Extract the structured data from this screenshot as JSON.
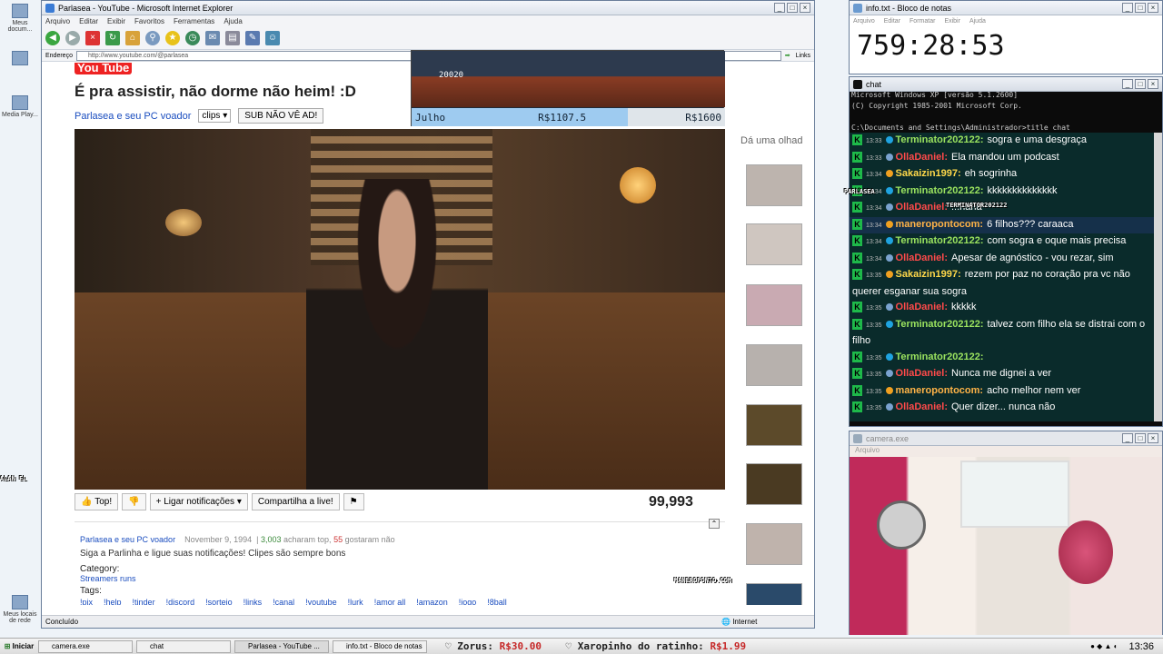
{
  "desktop": {
    "icons": [
      "Meus docum...",
      "",
      "Media Play...",
      "Meus locais de rede"
    ],
    "overlay_alan": "ALAN EL"
  },
  "ie": {
    "title": "Parlasea - YouTube - Microsoft Internet Explorer",
    "menu": [
      "Arquivo",
      "Editar",
      "Exibir",
      "Favoritos",
      "Ferramentas",
      "Ajuda"
    ],
    "address_label": "Endereço",
    "address": "http://www.youtube.com/@parlasea",
    "links": "Links",
    "status": "Concluído",
    "zone": "Internet"
  },
  "page": {
    "logo": "You Tube",
    "video_title": "É pra assistir, não dorme não heim! :D",
    "channel": "Parlasea e seu PC voador",
    "dropdown": "clips",
    "sub_button": "SUB NÃO VÊ AD!",
    "sidebar_hint": "Dá uma olhad",
    "actions": {
      "like": "Top!",
      "notify": "Ligar notificações",
      "share": "Compartilha a live!"
    },
    "views": "99,993",
    "desc": {
      "channel": "Parlasea e seu PC voador",
      "date": "November 9, 1994",
      "likes": "3,003",
      "likes_suffix": "acharam top,",
      "dislikes": "55",
      "dislikes_suffix": "gostaram não",
      "text": "Siga a Parlinha e ligue suas notificações! Clipes são sempre bons",
      "category_label": "Category:",
      "category": "Streamers runs",
      "tags_label": "Tags:",
      "tags": [
        "!pix",
        "!help",
        "!tinder",
        "!discord",
        "!sorteio",
        "!links",
        "!canal",
        "!youtube",
        "!lurk",
        "!amor all",
        "!amazon",
        "!jogo",
        "!8ball"
      ]
    },
    "overlay_manero": "MANEROPONTO.COM"
  },
  "game": {
    "month": "Julho",
    "money": "R$1107.5",
    "goal": "R$1600",
    "score": "20020"
  },
  "notepad": {
    "title": "info.txt - Bloco de notas",
    "menu": [
      "Arquivo",
      "Editar",
      "Formatar",
      "Exibir",
      "Ajuda"
    ],
    "clock": "759:28:53"
  },
  "chat": {
    "title": "chat",
    "header": "Microsoft Windows XP [versão 5.1.2600]\n(C) Copyright 1985-2001 Microsoft Corp.\n\nC:\\Documents and Settings\\Administrador>title chat\n\nC:\\Documents and Settings\\Administrador>chat start",
    "overlay_parlasea": "PARLASEA",
    "overlay_term": "TERMINATOR202122",
    "messages": [
      {
        "time": "13:33",
        "user": "Terminator202122:",
        "color": "green",
        "text": "sogra e uma desgraça",
        "hl": false
      },
      {
        "time": "13:33",
        "user": "OllaDaniel:",
        "color": "red",
        "text": "Ela mandou um podcast",
        "hl": false
      },
      {
        "time": "13:34",
        "user": "Sakaizin1997:",
        "color": "yellow",
        "text": "eh sogrinha",
        "hl": false
      },
      {
        "time": "13:34",
        "user": "Terminator202122:",
        "color": "green",
        "text": "kkkkkkkkkkkkkk",
        "hl": false
      },
      {
        "time": "13:34",
        "user": "OllaDaniel:",
        "color": "red",
        "text": "...haha",
        "hl": false
      },
      {
        "time": "13:34",
        "user": "maneropontocom:",
        "color": "orange",
        "text": "6 filhos??? caraaca",
        "hl": true
      },
      {
        "time": "13:34",
        "user": "Terminator202122:",
        "color": "green",
        "text": "com sogra e oque mais precisa",
        "hl": false
      },
      {
        "time": "13:34",
        "user": "OllaDaniel:",
        "color": "red",
        "text": "Apesar de agnóstico - vou rezar, sim",
        "hl": false
      },
      {
        "time": "13:35",
        "user": "Sakaizin1997:",
        "color": "yellow",
        "text": "rezem por paz no coração pra vc não querer esganar sua sogra",
        "hl": false
      },
      {
        "time": "13:35",
        "user": "OllaDaniel:",
        "color": "red",
        "text": "kkkkk",
        "hl": false
      },
      {
        "time": "13:35",
        "user": "Terminator202122:",
        "color": "green",
        "text": "talvez com filho ela se distrai com o filho",
        "hl": false
      },
      {
        "time": "13:35",
        "user": "Terminator202122:",
        "color": "green",
        "text": "",
        "hl": false
      },
      {
        "time": "13:35",
        "user": "OllaDaniel:",
        "color": "red",
        "text": "Nunca me dignei a ver",
        "hl": false
      },
      {
        "time": "13:35",
        "user": "maneropontocom:",
        "color": "orange",
        "text": "acho melhor nem ver",
        "hl": false
      },
      {
        "time": "13:35",
        "user": "OllaDaniel:",
        "color": "red",
        "text": "Quer dizer... nunca não",
        "hl": false
      }
    ]
  },
  "camera": {
    "title": "camera.exe",
    "menu": "Arquivo"
  },
  "taskbar": {
    "start": "Iniciar",
    "tasks": [
      "camera.exe",
      "chat",
      "Parlasea - YouTube ...",
      "info.txt - Bloco de notas"
    ],
    "ticker1_label": "Zorus:",
    "ticker1_value": "R$30.00",
    "ticker2_label": "Xaropinho do ratinho:",
    "ticker2_value": "R$1.99",
    "time": "13:36"
  }
}
